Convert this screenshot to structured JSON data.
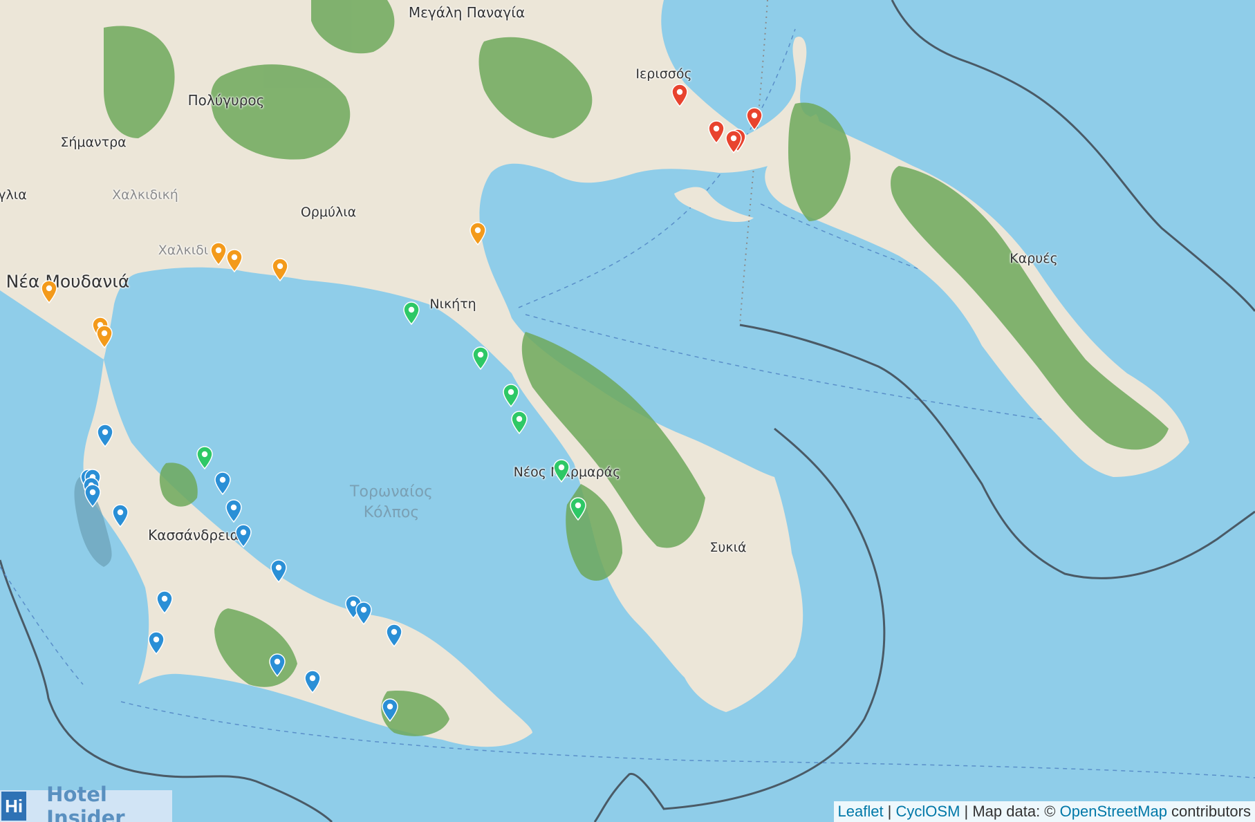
{
  "map": {
    "place_labels": [
      {
        "id": "megali-panagia",
        "text": "Μεγάλη Παναγία"
      },
      {
        "id": "ierissos",
        "text": "Ιερισσός"
      },
      {
        "id": "polygyros",
        "text": "Πολύγυρος"
      },
      {
        "id": "simantra",
        "text": "Σήμαντρα"
      },
      {
        "id": "glia",
        "text": "γλια"
      },
      {
        "id": "chalkidiki-region",
        "text": "Χαλκιδική"
      },
      {
        "id": "ormylia",
        "text": "Ορμύλια"
      },
      {
        "id": "chalkidiki-town",
        "text": "Χαλκιδι"
      },
      {
        "id": "nea-moudania",
        "text": "Νέα Μουδανιά"
      },
      {
        "id": "nikiti",
        "text": "Νικήτη"
      },
      {
        "id": "karyes",
        "text": "Καρυές"
      },
      {
        "id": "toronaios-kolpos",
        "text": "Τορωναίος Κόλπος"
      },
      {
        "id": "kassandreia",
        "text": "Κασσάνδρεια"
      },
      {
        "id": "neos-marmaras",
        "text": "Νέος Μαρμαράς"
      },
      {
        "id": "sykia",
        "text": "Συκιά"
      }
    ],
    "marker_colors": {
      "red": "#e8432e",
      "orange": "#f39a1b",
      "green": "#2ec866",
      "blue": "#2a8fd6"
    },
    "markers": [
      {
        "color": "red"
      },
      {
        "color": "red"
      },
      {
        "color": "red"
      },
      {
        "color": "red"
      },
      {
        "color": "red"
      },
      {
        "color": "orange"
      },
      {
        "color": "orange"
      },
      {
        "color": "orange"
      },
      {
        "color": "orange"
      },
      {
        "color": "orange"
      },
      {
        "color": "orange"
      },
      {
        "color": "orange"
      },
      {
        "color": "green"
      },
      {
        "color": "green"
      },
      {
        "color": "green"
      },
      {
        "color": "green"
      },
      {
        "color": "green"
      },
      {
        "color": "green"
      },
      {
        "color": "green"
      },
      {
        "color": "blue"
      },
      {
        "color": "blue"
      },
      {
        "color": "blue"
      },
      {
        "color": "blue"
      },
      {
        "color": "blue"
      },
      {
        "color": "blue"
      },
      {
        "color": "blue"
      },
      {
        "color": "blue"
      },
      {
        "color": "blue"
      },
      {
        "color": "blue"
      },
      {
        "color": "blue"
      },
      {
        "color": "blue"
      },
      {
        "color": "blue"
      },
      {
        "color": "blue"
      },
      {
        "color": "blue"
      },
      {
        "color": "blue"
      },
      {
        "color": "blue"
      },
      {
        "color": "blue"
      }
    ]
  },
  "logo": {
    "mark": "Hi",
    "text": "Hotel Insider"
  },
  "attribution": {
    "leaflet": "Leaflet",
    "sep1": " | ",
    "cyclosm": "CyclOSM",
    "mapdata": " | Map data: © ",
    "osm": "OpenStreetMap",
    "contributors": " contributors"
  },
  "colors": {
    "sea": "#8fcde9",
    "land": "#ece6d8",
    "forest": "#6ea85c",
    "boundary": "#4a5a66"
  }
}
